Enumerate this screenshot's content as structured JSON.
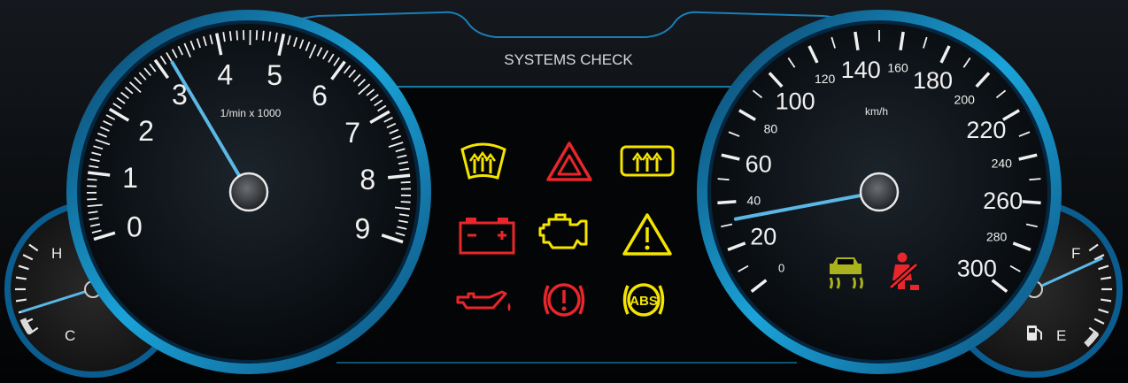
{
  "center_panel": {
    "title": "SYSTEMS CHECK"
  },
  "colors": {
    "accent_blue": "#1aa3d9",
    "needle": "#5ab7e6",
    "warning_red": "#e8262b",
    "warning_yellow": "#f4e400",
    "traction_olive": "#aab21e"
  },
  "tachometer": {
    "unit_label": "1/min x 1000",
    "scale_labels": [
      "0",
      "1",
      "2",
      "3",
      "4",
      "5",
      "6",
      "7",
      "8",
      "9"
    ],
    "needle_value": 3.2
  },
  "speedometer": {
    "unit_label": "km/h",
    "major_labels": [
      "0",
      "20",
      "40",
      "60",
      "80",
      "100",
      "120",
      "140",
      "160",
      "180",
      "200",
      "220",
      "240",
      "260",
      "280",
      "300"
    ],
    "needle_value": 32
  },
  "temperature_gauge": {
    "hot_label": "H",
    "cold_label": "C",
    "needle_level": 0.25
  },
  "fuel_gauge": {
    "full_label": "F",
    "empty_label": "E",
    "needle_level": 0.85
  },
  "warning_lights": [
    {
      "name": "front-defrost-icon",
      "color": "yellow"
    },
    {
      "name": "hazard-icon",
      "color": "red"
    },
    {
      "name": "rear-defrost-icon",
      "color": "yellow"
    },
    {
      "name": "battery-icon",
      "color": "red"
    },
    {
      "name": "check-engine-icon",
      "color": "yellow"
    },
    {
      "name": "general-warning-icon",
      "color": "yellow"
    },
    {
      "name": "oil-pressure-icon",
      "color": "red"
    },
    {
      "name": "brake-warning-icon",
      "color": "red"
    },
    {
      "name": "abs-icon",
      "color": "yellow",
      "text": "ABS"
    }
  ],
  "indicator_lights": [
    {
      "name": "traction-control-icon",
      "color": "olive"
    },
    {
      "name": "seatbelt-icon",
      "color": "red"
    }
  ]
}
